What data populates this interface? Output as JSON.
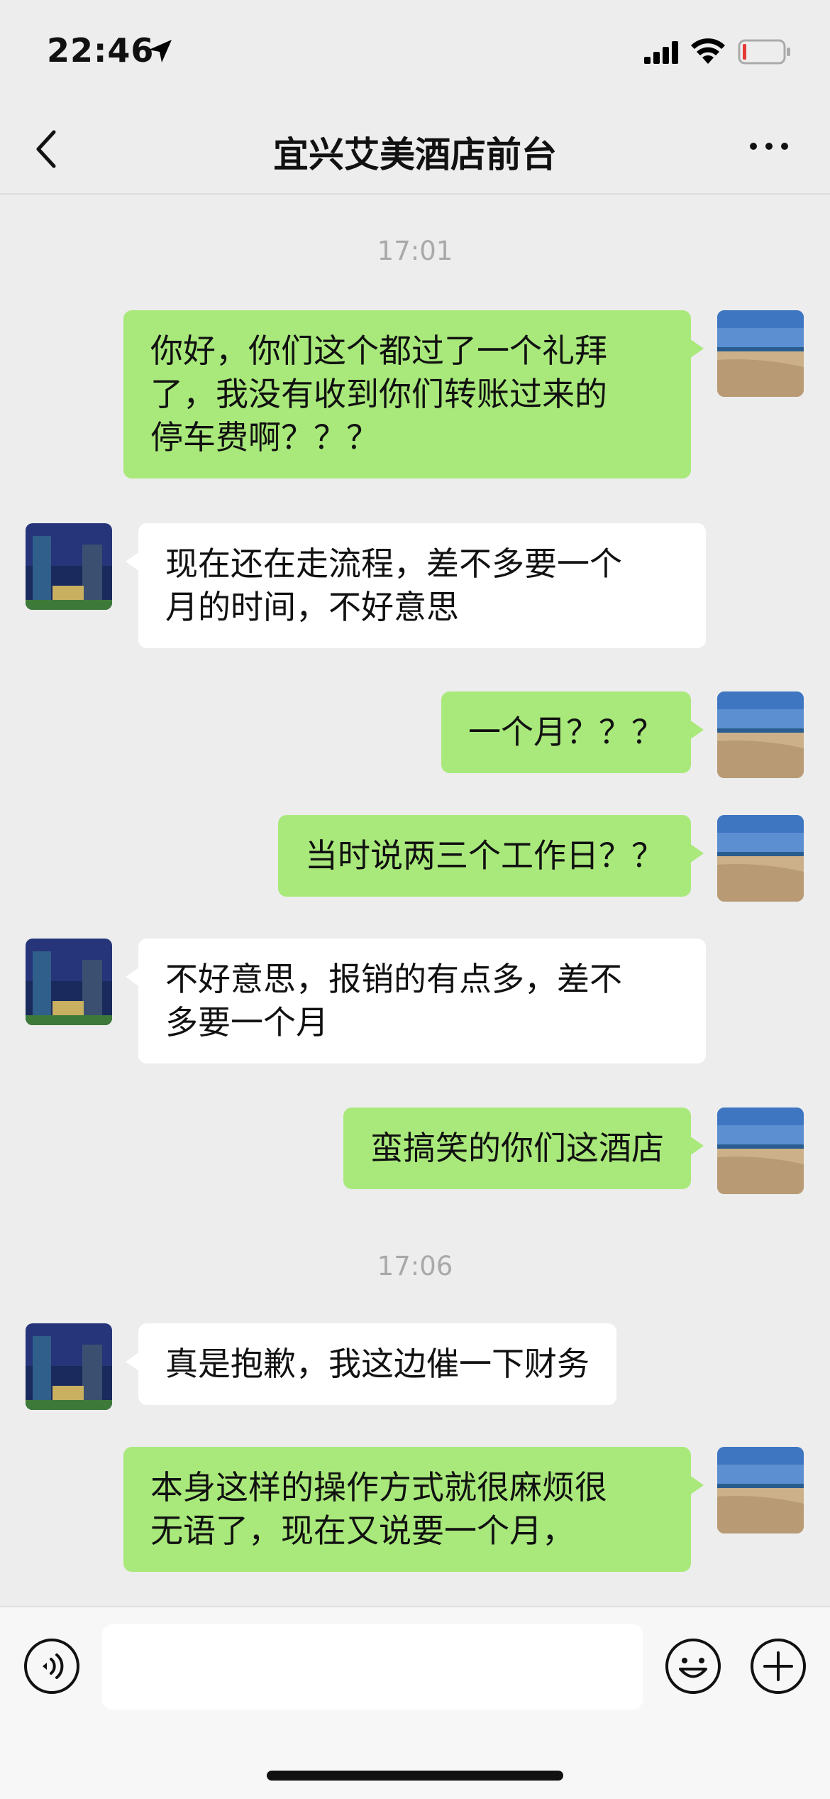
{
  "status_bar": {
    "time": "22:46",
    "icons": [
      "location-arrow-icon",
      "signal-icon",
      "wifi-icon",
      "battery-icon"
    ],
    "battery_color": "#e53935"
  },
  "nav": {
    "title": "宜兴艾美酒店前台",
    "back_icon": "chevron-left-icon",
    "more_icon": "more-dots-icon"
  },
  "colors": {
    "background": "#ededed",
    "outgoing_bubble": "#a9e97b",
    "incoming_bubble": "#ffffff",
    "timestamp": "#a9a9a9"
  },
  "chat": {
    "timestamps": [
      "17:01",
      "17:06"
    ],
    "messages": [
      {
        "sender": "me",
        "text": "你好，你们这个都过了一个礼拜\n了，我没有收到你们转账过来的\n停车费啊？？？"
      },
      {
        "sender": "hotel",
        "text": "现在还在走流程，差不多要一个\n月的时间，不好意思"
      },
      {
        "sender": "me",
        "text": "一个月？？？"
      },
      {
        "sender": "me",
        "text": "当时说两三个工作日？？"
      },
      {
        "sender": "hotel",
        "text": "不好意思，报销的有点多，差不\n多要一个月"
      },
      {
        "sender": "me",
        "text": "蛮搞笑的你们这酒店"
      },
      {
        "sender": "hotel",
        "text": "真是抱歉，我这边催一下财务"
      },
      {
        "sender": "me",
        "text": "本身这样的操作方式就很麻烦很\n无语了，现在又说要一个月，"
      }
    ]
  },
  "input_bar": {
    "value": "",
    "icons": [
      "voice-icon",
      "emoji-icon",
      "plus-icon"
    ]
  }
}
